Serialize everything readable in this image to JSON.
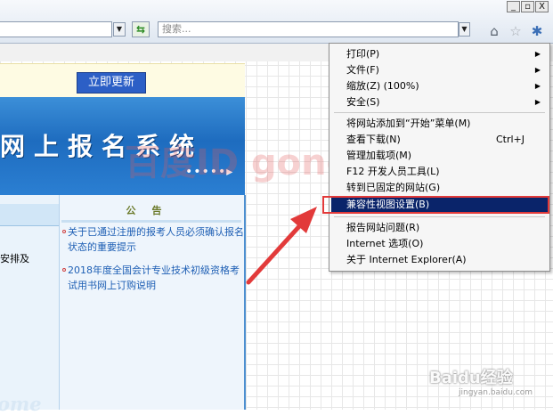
{
  "browser": {
    "search_placeholder": "搜索...",
    "window_buttons": [
      "_",
      "▫",
      "X"
    ]
  },
  "page": {
    "update_button": "立即更新",
    "banner_title": "网上报名系统",
    "banner_dots": "•••••▸",
    "left_partial_text": "安排及",
    "left_footer_text": "ome",
    "notice_title": "公告",
    "notice_items": [
      "关于已通过注册的报考人员必须确认报名状态的重要提示",
      "2018年度全国会计专业技术初级资格考试用书网上订购说明"
    ]
  },
  "watermarks": {
    "center": "百度ID gongzi",
    "baidu_logo": "Baidu经验",
    "baidu_url": "jingyan.baidu.com"
  },
  "tools_menu": {
    "items": [
      {
        "label": "打印(P)",
        "submenu": true
      },
      {
        "label": "文件(F)",
        "submenu": true
      },
      {
        "label": "缩放(Z) (100%)",
        "submenu": true
      },
      {
        "label": "安全(S)",
        "submenu": true
      },
      {
        "label": "将网站添加到“开始”菜单(M)"
      },
      {
        "label": "查看下载(N)",
        "shortcut": "Ctrl+J"
      },
      {
        "label": "管理加载项(M)"
      },
      {
        "label": "F12 开发人员工具(L)"
      },
      {
        "label": "转到已固定的网站(G)"
      },
      {
        "label": "兼容性视图设置(B)",
        "highlighted": true
      },
      {
        "label": "报告网站问题(R)"
      },
      {
        "label": "Internet 选项(O)"
      },
      {
        "label": "关于 Internet Explorer(A)"
      }
    ]
  },
  "colors": {
    "menu_highlight": "#0a246a",
    "annotation_red": "#e23a3a",
    "update_button": "#2c5fc6",
    "banner_blue": "#1e6cbf"
  }
}
